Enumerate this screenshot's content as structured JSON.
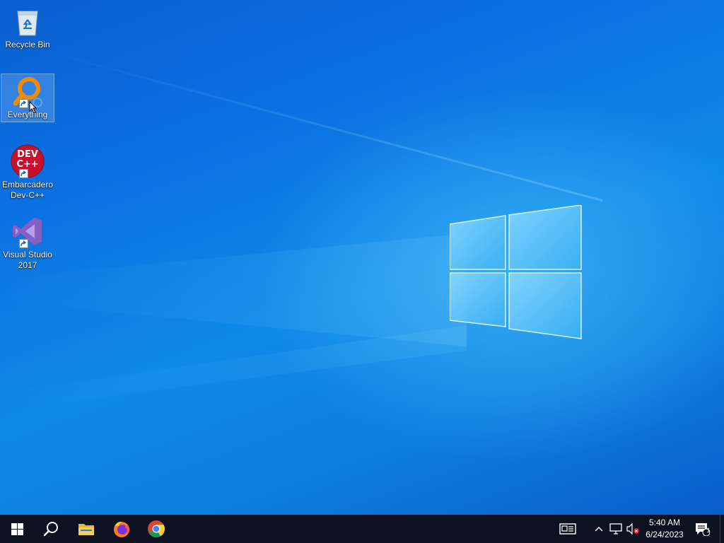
{
  "desktop": {
    "icons": [
      {
        "label": "Recycle Bin"
      },
      {
        "label": "Everything"
      },
      {
        "label": "Embarcadero Dev-C++"
      },
      {
        "label": "Visual Studio 2017"
      }
    ],
    "devcpp_icon_text": "DEV C++"
  },
  "taskbar": {
    "pinned": [
      "start-button",
      "search-button",
      "file-explorer",
      "firefox",
      "chrome"
    ],
    "clock": {
      "time": "5:40 AM",
      "date": "6/24/2023"
    },
    "notifications": {
      "count": "1"
    }
  },
  "colors": {
    "taskbar_bg": "#0d1220",
    "wallpaper_primary": "#0b6fe0",
    "accent_blue": "#0078d7"
  }
}
